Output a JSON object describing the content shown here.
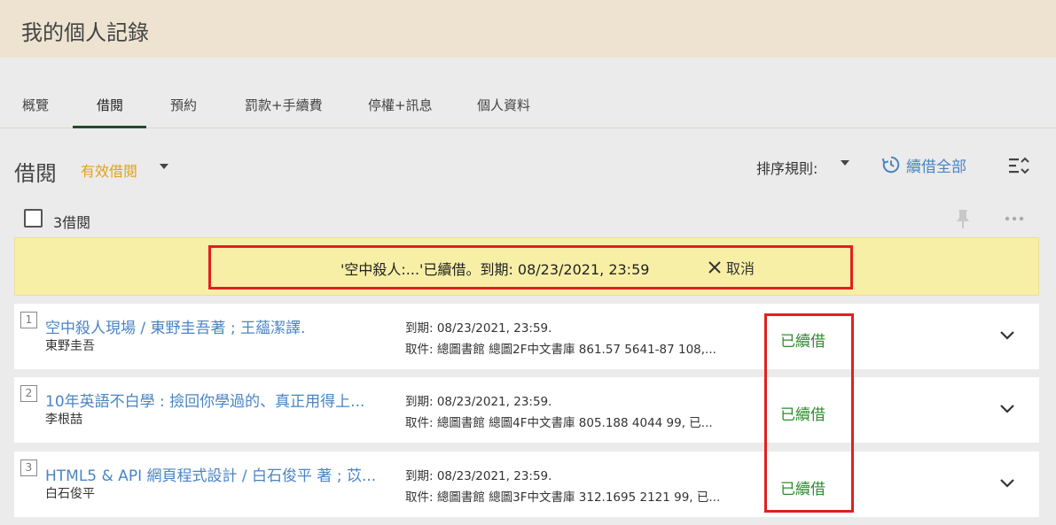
{
  "header": {
    "title": "我的個人記錄"
  },
  "tabs": [
    {
      "label": "概覽"
    },
    {
      "label": "借閱"
    },
    {
      "label": "預約"
    },
    {
      "label": "罰款+手續費"
    },
    {
      "label": "停權+訊息"
    },
    {
      "label": "個人資料"
    }
  ],
  "section": {
    "title": "借閱",
    "filter": "有效借閱",
    "sort_label": "排序規則:",
    "renew_all": "續借全部",
    "count_label": "3借閱"
  },
  "notice": {
    "text": "'空中殺人:...'已續借。到期:   08/23/2021, 23:59",
    "cancel": "取消"
  },
  "loans": [
    {
      "index": "1",
      "title": "空中殺人現場 / 東野圭吾著 ; 王蘊潔譯.",
      "author": "東野圭吾",
      "due": "到期: 08/23/2021, 23:59.",
      "pickup": "取件:  總圖書館 總圖2F中文書庫 861.57 5641-87 108,...",
      "status": "已續借"
    },
    {
      "index": "2",
      "title": "10年英語不白學 : 撿回你學過的、真正用得上...",
      "author": "李根喆",
      "due": "到期: 08/23/2021, 23:59.",
      "pickup": "取件:  總圖書館 總圖4F中文書庫 805.188 4044 99, 已...",
      "status": "已續借"
    },
    {
      "index": "3",
      "title": "HTML5 & API 網頁程式設計 / 白石俊平 著 ; 苡...",
      "author": "白石俊平",
      "due": "到期: 08/23/2021, 23:59.",
      "pickup": "取件:  總圖書館 總圖3F中文書庫 312.1695 2121 99, 已...",
      "status": "已續借"
    }
  ],
  "colors": {
    "header_bg": "#ede3d0",
    "link": "#4a84c4",
    "filter": "#e3a21a",
    "renewed_status": "#2f8c2f",
    "notice_bg": "#f8efa6",
    "highlight_box": "#e02020",
    "tab_active": "#1e4d2b"
  },
  "icons": {
    "renew_all": "clock-renew-icon",
    "view_toggle": "list-sort-icon",
    "pin": "pin-icon",
    "more": "more-horizontal-icon",
    "cancel": "close-icon",
    "expand": "chevron-down-icon"
  }
}
